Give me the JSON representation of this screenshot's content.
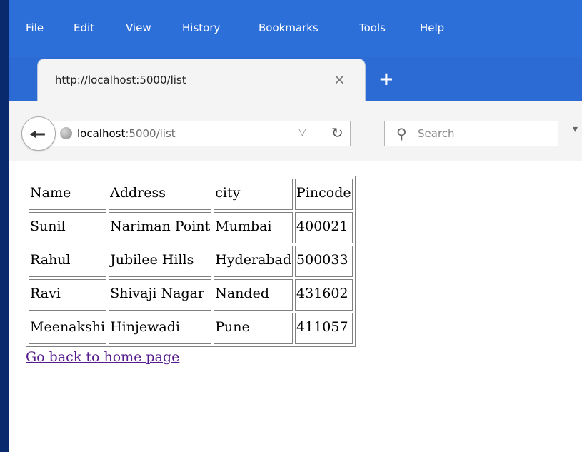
{
  "menu": [
    "File",
    "Edit",
    "View",
    "History",
    "Bookmarks",
    "Tools",
    "Help"
  ],
  "tab": {
    "title": "http://localhost:5000/list",
    "close_glyph": "×",
    "new_tab_glyph": "+"
  },
  "urlbar": {
    "host": "localhost",
    "path": ":5000/list"
  },
  "search": {
    "placeholder": "Search"
  },
  "table": {
    "headers": [
      "Name",
      "Address",
      "city",
      "Pincode"
    ],
    "rows": [
      [
        "Sunil",
        "Nariman Point",
        "Mumbai",
        "400021"
      ],
      [
        "Rahul",
        "Jubilee Hills",
        "Hyderabad",
        "500033"
      ],
      [
        "Ravi",
        "Shivaji Nagar",
        "Nanded",
        "431602"
      ],
      [
        "Meenakshi",
        "Hinjewadi",
        "Pune",
        "411057"
      ]
    ]
  },
  "link": {
    "text": "Go back to home page"
  },
  "icons": {
    "back": "back-arrow-icon",
    "site": "globe-icon",
    "dropdown": "dropdown-triangle-icon",
    "reload": "reload-icon",
    "search": "search-icon"
  },
  "colors": {
    "chrome": "#2b6bd3",
    "link_visited": "#551a8b"
  }
}
